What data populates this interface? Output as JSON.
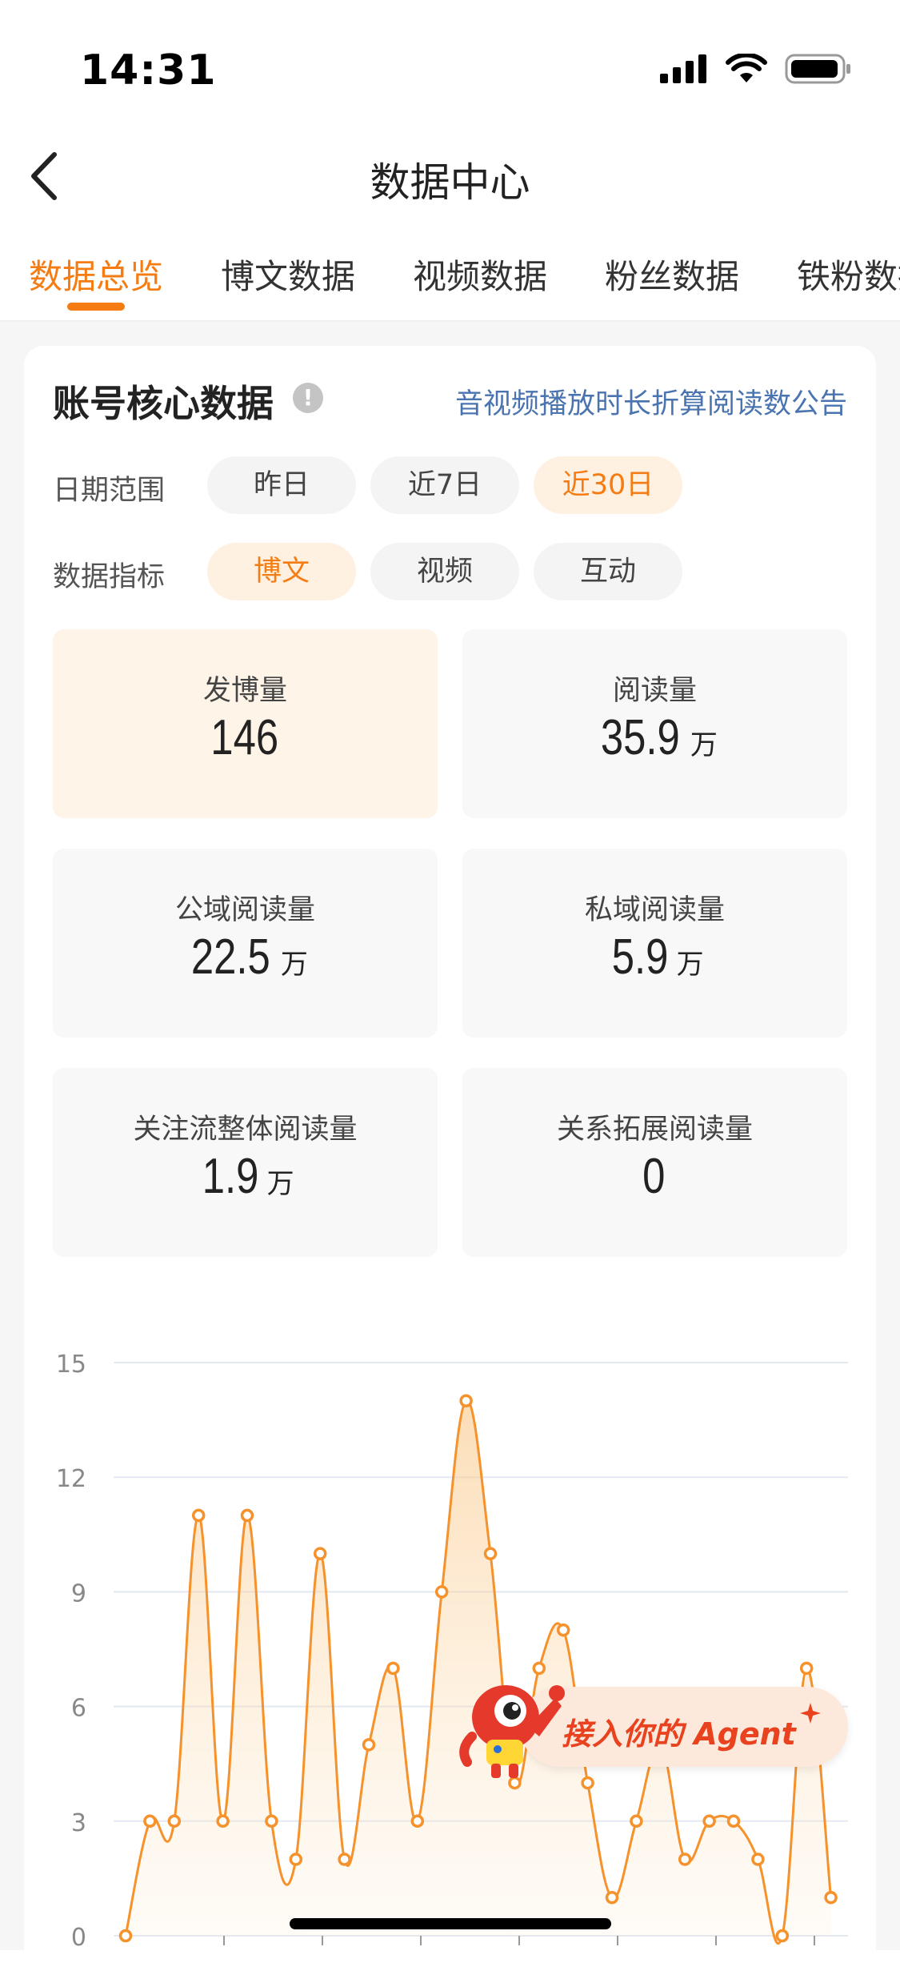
{
  "status": {
    "time": "14:31"
  },
  "nav": {
    "title": "数据中心"
  },
  "tabs": [
    {
      "label": "数据总览",
      "active": true
    },
    {
      "label": "博文数据",
      "active": false
    },
    {
      "label": "视频数据",
      "active": false
    },
    {
      "label": "粉丝数据",
      "active": false
    },
    {
      "label": "铁粉数据",
      "active": false
    }
  ],
  "card": {
    "title": "账号核心数据",
    "info_icon": "info-icon",
    "link": "音视频播放时长折算阅读数公告"
  },
  "filters": {
    "date": {
      "label": "日期范围",
      "options": [
        "昨日",
        "近7日",
        "近30日"
      ],
      "selected": "近30日"
    },
    "metric": {
      "label": "数据指标",
      "options": [
        "博文",
        "视频",
        "互动"
      ],
      "selected": "博文"
    }
  },
  "metrics": [
    {
      "label": "发博量",
      "value": "146",
      "unit": "",
      "active": true
    },
    {
      "label": "阅读量",
      "value": "35.9",
      "unit": "万",
      "active": false
    },
    {
      "label": "公域阅读量",
      "value": "22.5",
      "unit": "万",
      "active": false
    },
    {
      "label": "私域阅读量",
      "value": "5.9",
      "unit": "万",
      "active": false
    },
    {
      "label": "关注流整体阅读量",
      "value": "1.9",
      "unit": "万",
      "active": false
    },
    {
      "label": "关系拓展阅读量",
      "value": "0",
      "unit": "",
      "active": false
    }
  ],
  "agent": {
    "label": "接入你的 Agent"
  },
  "colors": {
    "accent": "#f57c12",
    "link": "#4a74b0",
    "agent_text": "#e8421e"
  },
  "chart_data": {
    "type": "area",
    "x": [
      1,
      2,
      3,
      4,
      5,
      6,
      7,
      8,
      9,
      10,
      11,
      12,
      13,
      14,
      15,
      16,
      17,
      18,
      19,
      20,
      21,
      22,
      23,
      24,
      25,
      26,
      27,
      28,
      29,
      30
    ],
    "series": [
      {
        "values": [
          0,
          3,
          3,
          11,
          3,
          11,
          3,
          2,
          10,
          2,
          5,
          7,
          3,
          9,
          14,
          10,
          4,
          7,
          8,
          4,
          1,
          3,
          5,
          2,
          3,
          3,
          2,
          0,
          7,
          1
        ]
      }
    ],
    "ylim": [
      0,
      15
    ],
    "yticks": [
      0,
      3,
      6,
      9,
      12,
      15
    ],
    "grid": true,
    "color": "#f5922c"
  }
}
